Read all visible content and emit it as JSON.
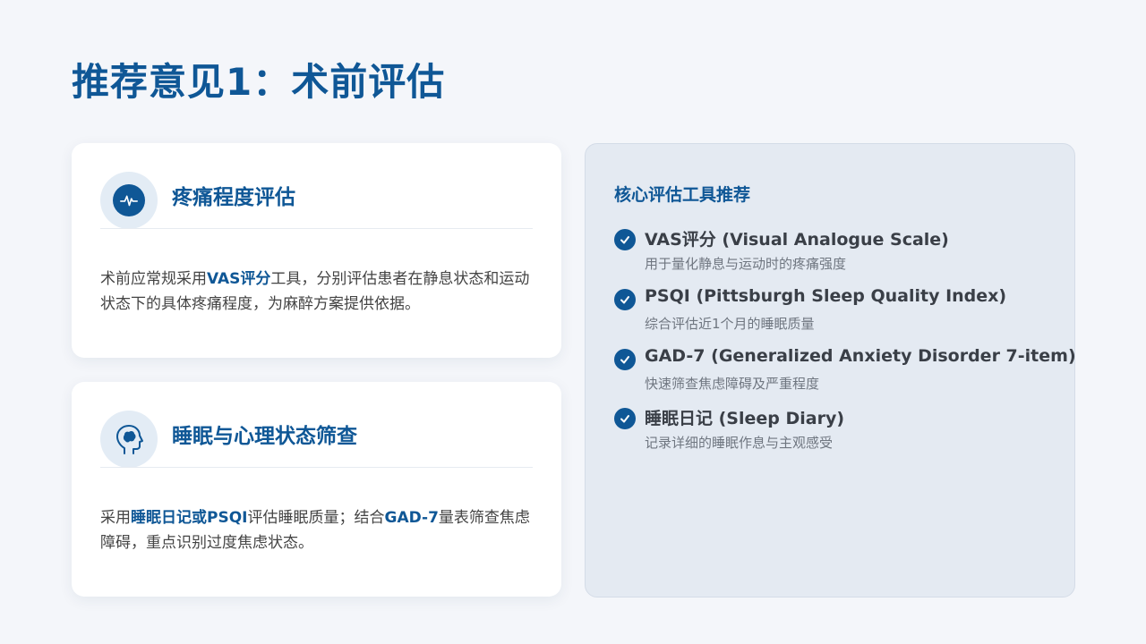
{
  "page": {
    "title": "推荐意见1：术前评估"
  },
  "cards": [
    {
      "title": "疼痛程度评估",
      "icon": "heartbeat-icon",
      "body": {
        "part1": "术前应常规采用",
        "hl1": "VAS评分",
        "part2": "工具，分别评估患者在静息状态和运动状态下的具体疼痛程度，为麻醉方案提供依据。"
      }
    },
    {
      "title": "睡眠与心理状态筛查",
      "icon": "head-brain-icon",
      "body": {
        "part1": "采用",
        "hl1": "睡眠日记或PSQI",
        "part2": "评估睡眠质量；结合",
        "hl2": "GAD-7",
        "part3": "量表筛查焦虑障碍，重点识别过度焦虑状态。"
      }
    }
  ],
  "panel": {
    "title": "核心评估工具推荐",
    "tools": [
      {
        "name": "VAS评分 (Visual Analogue Scale)",
        "desc": "用于量化静息与运动时的疼痛强度"
      },
      {
        "name": "PSQI (Pittsburgh Sleep Quality Index)",
        "desc": "综合评估近1个月的睡眠质量"
      },
      {
        "name": "GAD-7 (Generalized Anxiety Disorder 7-item)",
        "desc": "快速筛查焦虑障碍及严重程度"
      },
      {
        "name": "睡眠日记 (Sleep Diary)",
        "desc": "记录详细的睡眠作息与主观感受"
      }
    ]
  },
  "colors": {
    "accent": "#0f5796",
    "background": "#f4f6fa",
    "panel": "#e4eaf2"
  }
}
